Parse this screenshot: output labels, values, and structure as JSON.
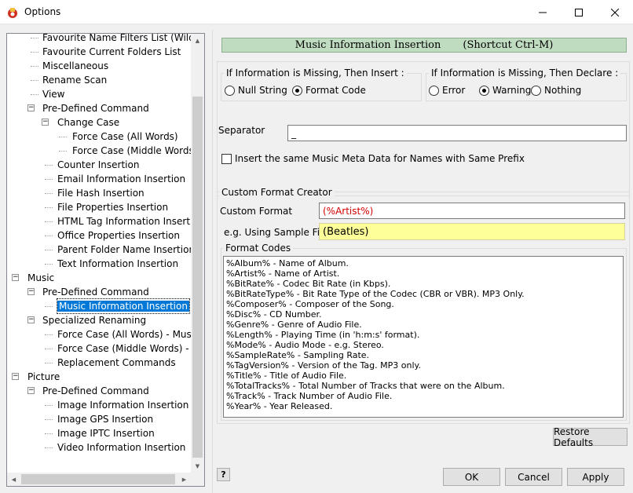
{
  "window": {
    "title": "Options"
  },
  "tree": {
    "items": [
      {
        "label": "Favourite Name Filters List (Wildcard",
        "level": 2
      },
      {
        "label": "Favourite Current Folders List",
        "level": 2
      },
      {
        "label": "Miscellaneous",
        "level": 2
      },
      {
        "label": "Rename Scan",
        "level": 2
      },
      {
        "label": "View",
        "level": 2
      },
      {
        "label": "Pre-Defined Command",
        "level": 2,
        "expander": "−"
      },
      {
        "label": "Change Case",
        "level": 3,
        "expander": "−"
      },
      {
        "label": "Force Case (All Words)",
        "level": 4
      },
      {
        "label": "Force Case (Middle Words)",
        "level": 4
      },
      {
        "label": "Counter Insertion",
        "level": 3
      },
      {
        "label": "Email Information Insertion",
        "level": 3
      },
      {
        "label": "File Hash Insertion",
        "level": 3
      },
      {
        "label": "File Properties Insertion",
        "level": 3
      },
      {
        "label": "HTML Tag Information Insertion",
        "level": 3
      },
      {
        "label": "Office Properties Insertion",
        "level": 3
      },
      {
        "label": "Parent Folder Name Insertion",
        "level": 3
      },
      {
        "label": "Text Information Insertion",
        "level": 3
      },
      {
        "label": "Music",
        "level": 1,
        "expander": "−"
      },
      {
        "label": "Pre-Defined Command",
        "level": 2,
        "expander": "−"
      },
      {
        "label": "Music Information Insertion",
        "level": 3,
        "selected": true
      },
      {
        "label": "Specialized Renaming",
        "level": 2,
        "expander": "−"
      },
      {
        "label": "Force Case (All Words) - Music",
        "level": 3
      },
      {
        "label": "Force Case (Middle Words) - Mu",
        "level": 3
      },
      {
        "label": "Replacement Commands",
        "level": 3
      },
      {
        "label": "Picture",
        "level": 1,
        "expander": "−"
      },
      {
        "label": "Pre-Defined Command",
        "level": 2,
        "expander": "−"
      },
      {
        "label": "Image Information Insertion",
        "level": 3
      },
      {
        "label": "Image GPS Insertion",
        "level": 3
      },
      {
        "label": "Image IPTC Insertion",
        "level": 3
      },
      {
        "label": "Video Information Insertion",
        "level": 3
      }
    ]
  },
  "panel": {
    "header_title": "Music Information Insertion",
    "header_shortcut": "(Shortcut Ctrl-M)",
    "missing_insert": {
      "title": "If Information is Missing, Then Insert :",
      "options": [
        "Null String",
        "Format Code"
      ],
      "selected": "Format Code"
    },
    "missing_declare": {
      "title": "If Information is Missing, Then Declare :",
      "options": [
        "Error",
        "Warning",
        "Nothing"
      ],
      "selected": "Warning"
    },
    "separator_label": "Separator",
    "separator_value": "_",
    "same_prefix_checkbox": "Insert the same Music Meta Data for Names with Same Prefix",
    "custom_format_creator": "Custom Format Creator",
    "custom_format_label": "Custom Format",
    "custom_format_value": "(%Artist%)",
    "sample_label": "e.g. Using Sample File:",
    "sample_value": "(Beatles)",
    "format_codes_title": "Format Codes",
    "format_codes": [
      "%Album%   - Name of Album.",
      "%Artist%   - Name of Artist.",
      "%BitRate%   - Codec Bit Rate (in Kbps).",
      "%BitRateType%  - Bit Rate Type of the Codec (CBR or VBR).  MP3 Only.",
      "%Composer%   - Composer of the Song.",
      "%Disc%   - CD Number.",
      "%Genre%   - Genre of Audio File.",
      "%Length%   - Playing Time (in 'h:m:s' format).",
      "%Mode%   - Audio Mode - e.g. Stereo.",
      "%SampleRate%   - Sampling Rate.",
      "%TagVersion%   - Version of the Tag. MP3 only.",
      "%Title%   - Title of Audio File.",
      "%TotalTracks%   - Total Number of Tracks that were on the Album.",
      "%Track%   - Track Number of Audio File.",
      "%Year%   - Year Released."
    ],
    "restore_defaults": "Restore Defaults"
  },
  "footer": {
    "help": "?",
    "ok": "OK",
    "cancel": "Cancel",
    "apply": "Apply"
  }
}
